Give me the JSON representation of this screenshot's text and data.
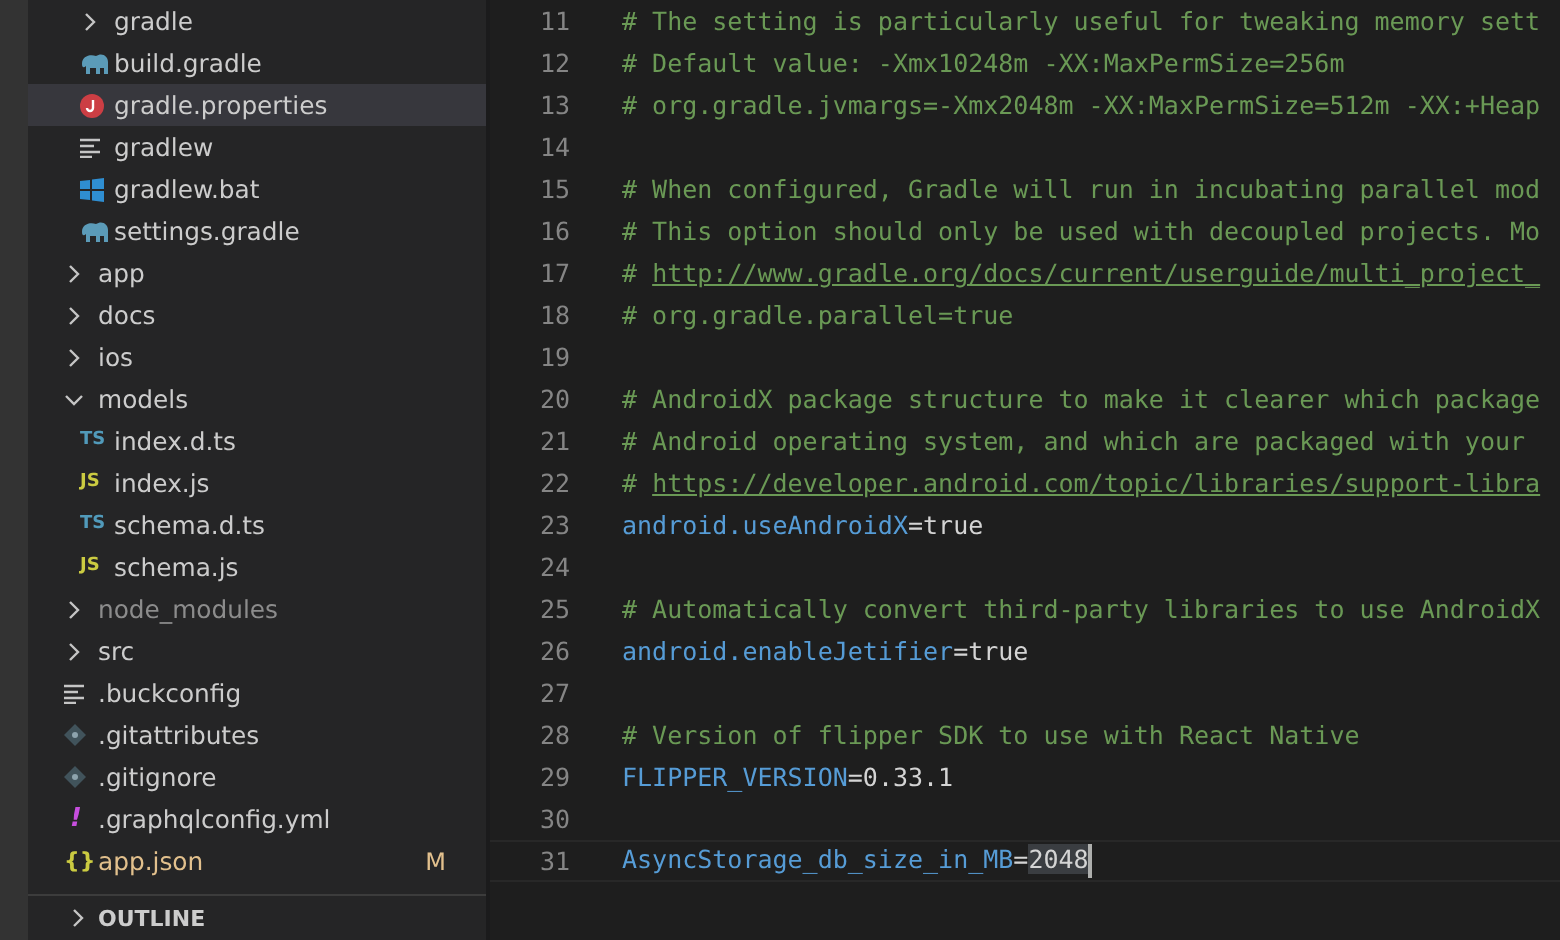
{
  "explorer": {
    "tree": [
      {
        "children": [
          {
            "label": "gradle",
            "kind": "folder",
            "expanded": false,
            "selected": false
          },
          {
            "label": "build.gradle",
            "kind": "gradle",
            "selected": false
          },
          {
            "label": "gradle.properties",
            "kind": "properties",
            "selected": true
          },
          {
            "label": "gradlew",
            "kind": "lines",
            "selected": false
          },
          {
            "label": "gradlew.bat",
            "kind": "windows",
            "selected": false
          },
          {
            "label": "settings.gradle",
            "kind": "gradle",
            "selected": false
          }
        ]
      },
      {
        "label": "app",
        "kind": "folder",
        "expanded": false,
        "selected": false
      },
      {
        "label": "docs",
        "kind": "folder",
        "expanded": false,
        "selected": false
      },
      {
        "label": "ios",
        "kind": "folder",
        "expanded": false,
        "selected": false
      },
      {
        "label": "models",
        "kind": "folder",
        "expanded": true,
        "selected": false,
        "children": [
          {
            "label": "index.d.ts",
            "kind": "ts",
            "icon_text": "TS",
            "selected": false
          },
          {
            "label": "index.js",
            "kind": "js",
            "icon_text": "JS",
            "selected": false
          },
          {
            "label": "schema.d.ts",
            "kind": "ts",
            "icon_text": "TS",
            "selected": false
          },
          {
            "label": "schema.js",
            "kind": "js",
            "icon_text": "JS",
            "selected": false
          }
        ]
      },
      {
        "label": "node_modules",
        "kind": "folder",
        "expanded": false,
        "ignored": true,
        "selected": false
      },
      {
        "label": "src",
        "kind": "folder",
        "expanded": false,
        "selected": false
      },
      {
        "label": ".buckconfig",
        "kind": "lines",
        "selected": false
      },
      {
        "label": ".gitattributes",
        "kind": "git",
        "selected": false
      },
      {
        "label": ".gitignore",
        "kind": "git",
        "selected": false
      },
      {
        "label": ".graphqlconfig.yml",
        "kind": "graphql",
        "icon_text": "!",
        "selected": false
      },
      {
        "label": "app.json",
        "kind": "json",
        "icon_text": "{}",
        "status": "M",
        "selected": false
      }
    ]
  },
  "outline": {
    "title": "OUTLINE",
    "expanded": false
  },
  "editor": {
    "lines": [
      {
        "number": "11",
        "kind": "comment",
        "text": "# The setting is particularly useful for tweaking memory sett"
      },
      {
        "number": "12",
        "kind": "comment",
        "text": "# Default value: -Xmx10248m -XX:MaxPermSize=256m"
      },
      {
        "number": "13",
        "kind": "comment",
        "text": "# org.gradle.jvmargs=-Xmx2048m -XX:MaxPermSize=512m -XX:+Heap"
      },
      {
        "number": "14",
        "kind": "blank"
      },
      {
        "number": "15",
        "kind": "comment",
        "text": "# When configured, Gradle will run in incubating parallel mod"
      },
      {
        "number": "16",
        "kind": "comment",
        "text": "# This option should only be used with decoupled projects. Mo"
      },
      {
        "number": "17",
        "kind": "link",
        "text": "# ",
        "url": "http://www.gradle.org/docs/current/userguide/multi_project_"
      },
      {
        "number": "18",
        "kind": "comment",
        "text": "# org.gradle.parallel=true"
      },
      {
        "number": "19",
        "kind": "blank"
      },
      {
        "number": "20",
        "kind": "comment",
        "text": "# AndroidX package structure to make it clearer which package"
      },
      {
        "number": "21",
        "kind": "comment",
        "text": "# Android operating system, and which are packaged with your"
      },
      {
        "number": "22",
        "kind": "link",
        "text": "# ",
        "url": "https://developer.android.com/topic/libraries/support-libra"
      },
      {
        "number": "23",
        "kind": "property",
        "key": "android.useAndroidX",
        "sep": "=",
        "value": "true"
      },
      {
        "number": "24",
        "kind": "blank"
      },
      {
        "number": "25",
        "kind": "comment",
        "text": "# Automatically convert third-party libraries to use AndroidX"
      },
      {
        "number": "26",
        "kind": "property",
        "key": "android.enableJetifier",
        "sep": "=",
        "value": "true"
      },
      {
        "number": "27",
        "kind": "blank"
      },
      {
        "number": "28",
        "kind": "comment",
        "text": "# Version of flipper SDK to use with React Native"
      },
      {
        "number": "29",
        "kind": "property",
        "key": "FLIPPER_VERSION",
        "sep": "=",
        "value": "0.33.1"
      },
      {
        "number": "30",
        "kind": "blank"
      },
      {
        "number": "31",
        "kind": "property",
        "key": "AsyncStorage_db_size_in_MB",
        "sep": "=",
        "value": "2048",
        "current": true,
        "value_selected": true
      }
    ]
  }
}
